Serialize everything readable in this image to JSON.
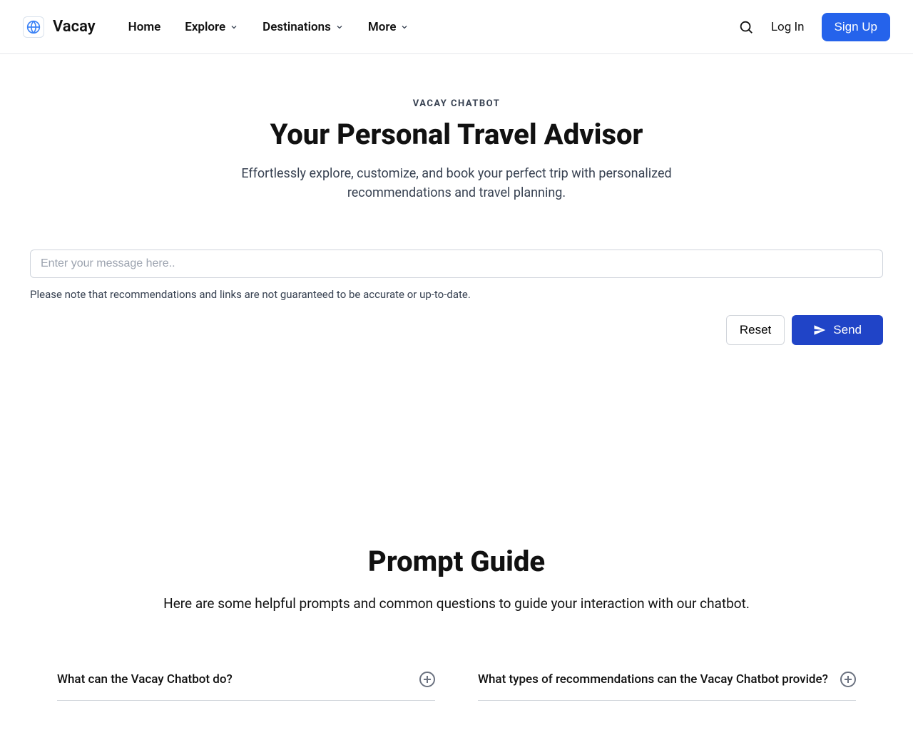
{
  "brand": {
    "name": "Vacay"
  },
  "nav": {
    "items": [
      {
        "label": "Home",
        "has_dropdown": false
      },
      {
        "label": "Explore",
        "has_dropdown": true
      },
      {
        "label": "Destinations",
        "has_dropdown": true
      },
      {
        "label": "More",
        "has_dropdown": true
      }
    ]
  },
  "header": {
    "login": "Log In",
    "signup": "Sign Up"
  },
  "hero": {
    "eyebrow": "VACAY CHATBOT",
    "title": "Your Personal Travel Advisor",
    "subtitle": "Effortlessly explore, customize, and book your perfect trip with personalized recommendations and travel planning."
  },
  "chat": {
    "input_placeholder": "Enter your message here..",
    "disclaimer": "Please note that recommendations and links are not guaranteed to be accurate or up-to-date.",
    "reset_label": "Reset",
    "send_label": "Send"
  },
  "guide": {
    "title": "Prompt Guide",
    "subtitle": "Here are some helpful prompts and common questions to guide your interaction with our chatbot."
  },
  "faq": [
    {
      "q": "What can the Vacay Chatbot do?"
    },
    {
      "q": "What types of recommendations can the Vacay Chatbot provide?"
    }
  ]
}
